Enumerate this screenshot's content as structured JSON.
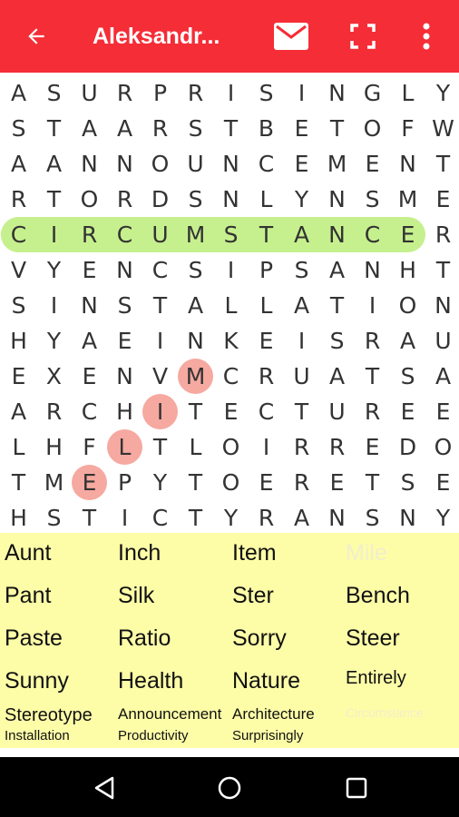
{
  "appbar": {
    "title": "Aleksandr...",
    "icons": [
      "back-arrow-icon",
      "mail-icon",
      "fullscreen-icon",
      "more-vert-icon"
    ]
  },
  "grid": {
    "rows": [
      "ASURPRISINGLY",
      "STAARSTBETOFW",
      "AANNOUNCEMENT",
      "RTORDSNLYNSME",
      "CIRCUMSTANCER",
      "VYENCSIPSANHT",
      "SINSTALLATION",
      "HYAEINKEISRAU",
      "EXENVMCRUATSA",
      "ARCHITECTUREE",
      "LHFLTLOIRREDO",
      "TMEPYTOERETSE",
      "HSTICTYRANSNY"
    ],
    "found_highlight_color": "#c6f08e",
    "selection_highlight_color": "#f6a9a0"
  },
  "words": [
    {
      "text": "Aunt",
      "found": false
    },
    {
      "text": "Inch",
      "found": false
    },
    {
      "text": "Item",
      "found": false
    },
    {
      "text": "Mile",
      "found": true
    },
    {
      "text": "Pant",
      "found": false
    },
    {
      "text": "Silk",
      "found": false
    },
    {
      "text": "Ster",
      "found": false
    },
    {
      "text": "Bench",
      "found": false
    },
    {
      "text": "Paste",
      "found": false
    },
    {
      "text": "Ratio",
      "found": false
    },
    {
      "text": "Sorry",
      "found": false
    },
    {
      "text": "Steer",
      "found": false
    },
    {
      "text": "Sunny",
      "found": false
    },
    {
      "text": "Health",
      "found": false
    },
    {
      "text": "Nature",
      "found": false
    },
    {
      "text": "Entirely",
      "found": false
    },
    {
      "text": "Stereotype",
      "found": false
    },
    {
      "text": "Announcement",
      "found": false
    },
    {
      "text": "Architecture",
      "found": false
    },
    {
      "text": "Circumstance",
      "found": true
    },
    {
      "text": "Installation",
      "found": false
    },
    {
      "text": "Productivity",
      "found": false
    },
    {
      "text": "Surprisingly",
      "found": false
    }
  ]
}
